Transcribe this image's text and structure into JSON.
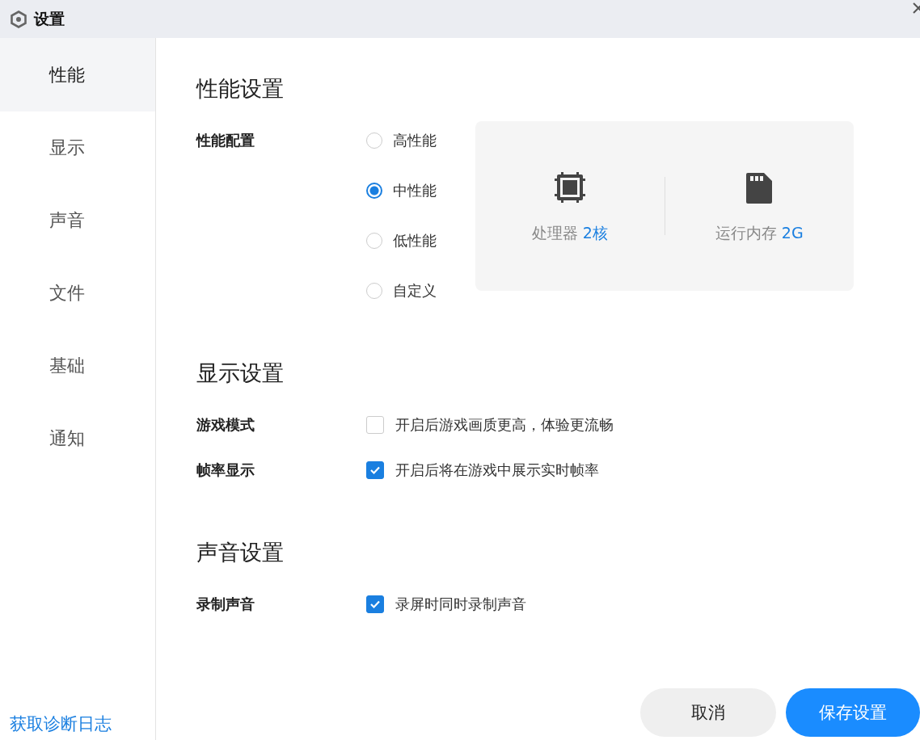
{
  "window": {
    "title": "设置"
  },
  "sidebar": {
    "items": [
      {
        "label": "性能",
        "selected": true
      },
      {
        "label": "显示",
        "selected": false
      },
      {
        "label": "声音",
        "selected": false
      },
      {
        "label": "文件",
        "selected": false
      },
      {
        "label": "基础",
        "selected": false
      },
      {
        "label": "通知",
        "selected": false
      }
    ],
    "footer_link": "获取诊断日志"
  },
  "sections": [
    {
      "title": "性能设置",
      "rows": [
        {
          "kind": "radio",
          "label": "性能配置",
          "options": [
            {
              "label": "高性能",
              "selected": false
            },
            {
              "label": "中性能",
              "selected": true
            },
            {
              "label": "低性能",
              "selected": false
            },
            {
              "label": "自定义",
              "selected": false
            }
          ],
          "specs": [
            {
              "kind": "cpu",
              "label": "处理器",
              "value": "2核"
            },
            {
              "kind": "memory",
              "label": "运行内存",
              "value": "2G"
            }
          ]
        }
      ]
    },
    {
      "title": "显示设置",
      "rows": [
        {
          "kind": "checkbox",
          "label": "游戏模式",
          "text": "开启后游戏画质更高，体验更流畅",
          "checked": false
        },
        {
          "kind": "checkbox",
          "label": "帧率显示",
          "text": "开启后将在游戏中展示实时帧率",
          "checked": true
        }
      ]
    },
    {
      "title": "声音设置",
      "rows": [
        {
          "kind": "checkbox",
          "label": "录制声音",
          "text": "录屏时同时录制声音",
          "checked": true
        }
      ]
    }
  ],
  "buttons": [
    {
      "kind": "secondary",
      "label": "取消"
    },
    {
      "kind": "primary",
      "label": "保存设置"
    }
  ]
}
